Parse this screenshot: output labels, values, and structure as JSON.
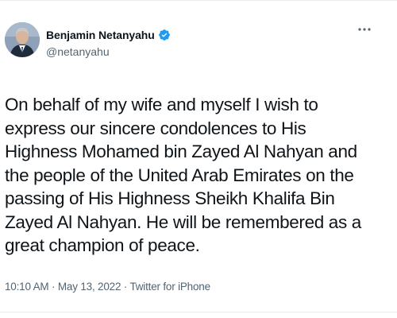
{
  "tweet": {
    "author": {
      "display_name": "Benjamin Netanyahu",
      "handle": "@netanyahu",
      "verified": true,
      "avatar_icon": "profile-photo",
      "verified_icon": "verified-badge-icon"
    },
    "more_icon": "more-options-icon",
    "text": "On behalf of my wife and myself I wish to express our sincere condolences to His Highness Mohamed bin Zayed Al Nahyan and the people of the United Arab Emirates on the passing of His Highness Sheikh Khalifa Bin Zayed Al Nahyan. He will be remembered as a great champion of peace.",
    "meta": {
      "time": "10:10 AM",
      "separator": "·",
      "date": "May 13, 2022",
      "client": "Twitter for iPhone"
    }
  },
  "colors": {
    "text_primary": "#0f1419",
    "text_secondary": "#536471",
    "verified_blue": "#1d9bf0",
    "divider": "#e6ecf0"
  }
}
